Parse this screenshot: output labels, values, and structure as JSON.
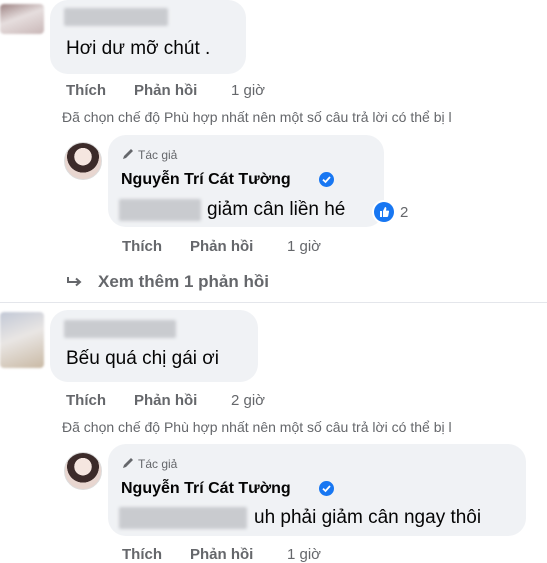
{
  "comments": [
    {
      "text": "Hơi dư mỡ chút .",
      "actions": {
        "like": "Thích",
        "reply": "Phản hồi",
        "time": "1 giờ"
      },
      "note": "Đã chọn chế độ Phù hợp nhất nên một số câu trả lời có thể bị l",
      "reply": {
        "author_tag": "Tác giả",
        "author_name": "Nguyễn Trí Cát Tường",
        "text": "giảm cân liền hé",
        "reaction_count": "2",
        "actions": {
          "like": "Thích",
          "reply": "Phản hồi",
          "time": "1 giờ"
        }
      },
      "more_replies": "Xem thêm 1 phản hồi"
    },
    {
      "text": "Bếu quá chị gái ơi",
      "actions": {
        "like": "Thích",
        "reply": "Phản hồi",
        "time": "2 giờ"
      },
      "note": "Đã chọn chế độ Phù hợp nhất nên một số câu trả lời có thể bị l",
      "reply": {
        "author_tag": "Tác giả",
        "author_name": "Nguyễn Trí Cát Tường",
        "text": "uh phải giảm cân ngay thôi",
        "actions": {
          "like": "Thích",
          "reply": "Phản hồi",
          "time": "1 giờ"
        }
      }
    }
  ],
  "colors": {
    "accent": "#1877f2",
    "bubble": "#f0f2f5",
    "muted": "#65676b"
  },
  "icons": {
    "verified": "verified-badge-icon",
    "like": "like-reaction-icon",
    "pencil": "pencil-icon",
    "reply_arrow": "reply-arrow-icon"
  }
}
